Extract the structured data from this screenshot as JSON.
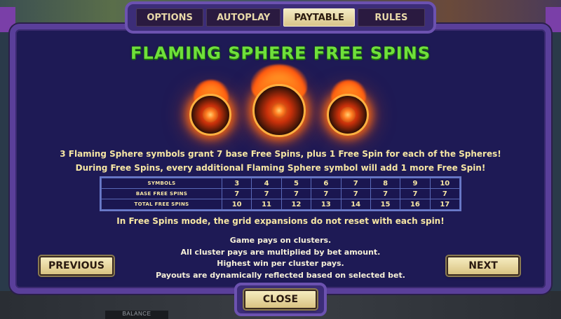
{
  "tabs": [
    {
      "label": "OPTIONS",
      "active": false
    },
    {
      "label": "AUTOPLAY",
      "active": false
    },
    {
      "label": "PAYTABLE",
      "active": true
    },
    {
      "label": "RULES",
      "active": false
    }
  ],
  "title": "FLAMING SPHERE FREE SPINS",
  "description": {
    "line1": "3 Flaming Sphere symbols grant 7 base Free Spins, plus 1 Free Spin for each of the Spheres!",
    "line2": "During Free Spins, every additional Flaming Sphere symbol will add 1 more Free Spin!"
  },
  "table": {
    "rows": [
      {
        "label": "SYMBOLS",
        "values": [
          "3",
          "4",
          "5",
          "6",
          "7",
          "8",
          "9",
          "10"
        ]
      },
      {
        "label": "BASE FREE SPINS",
        "values": [
          "7",
          "7",
          "7",
          "7",
          "7",
          "7",
          "7",
          "7"
        ]
      },
      {
        "label": "TOTAL FREE SPINS",
        "values": [
          "10",
          "11",
          "12",
          "13",
          "14",
          "15",
          "16",
          "17"
        ]
      }
    ]
  },
  "grid_note": "In Free Spins mode, the grid expansions do not reset with each spin!",
  "notes": [
    "Game pays on clusters.",
    "All cluster pays are multiplied by bet amount.",
    "Highest win per cluster pays.",
    "Payouts are dynamically reflected based on selected bet."
  ],
  "buttons": {
    "previous": "PREVIOUS",
    "next": "NEXT",
    "close": "CLOSE"
  },
  "bottom_bar": {
    "balance_label": "BALANCE"
  },
  "colors": {
    "panel_bg": "#1e1a55",
    "panel_border": "#5a3f9a",
    "title": "#6fe03a",
    "text": "#f6e6a4",
    "button": "#e8dca4"
  }
}
